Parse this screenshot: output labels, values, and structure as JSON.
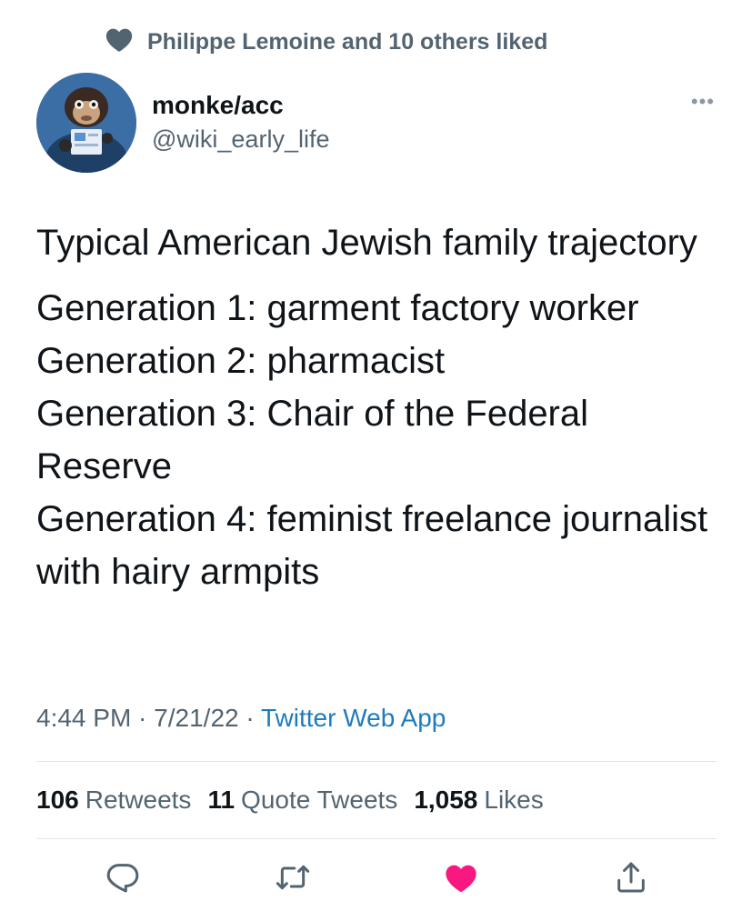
{
  "social_context": {
    "icon": "heart-icon",
    "text": "Philippe Lemoine and 10 others liked"
  },
  "author": {
    "display_name": "monke/acc",
    "handle": "@wiki_early_life",
    "avatar": "monkey-avatar"
  },
  "more_menu": "•••",
  "tweet": {
    "paragraph_1": "Typical American Jewish family trajectory",
    "paragraph_2_lines": [
      "Generation 1: garment factory worker",
      "Generation 2: pharmacist",
      "Generation 3: Chair of the Federal Reserve",
      "Generation 4: feminist freelance journalist with hairy armpits"
    ]
  },
  "meta": {
    "time": "4:44 PM",
    "separator": " · ",
    "date": "7/21/22",
    "source": "Twitter Web App"
  },
  "stats": {
    "retweets_count": "106",
    "retweets_label": "Retweets",
    "quotes_count": "11",
    "quotes_label": "Quote Tweets",
    "likes_count": "1,058",
    "likes_label": "Likes"
  },
  "actions": {
    "reply_icon": "reply-icon",
    "retweet_icon": "retweet-icon",
    "like_icon": "heart-icon",
    "share_icon": "share-icon",
    "like_color": "#f91880",
    "icon_color": "#536471"
  }
}
